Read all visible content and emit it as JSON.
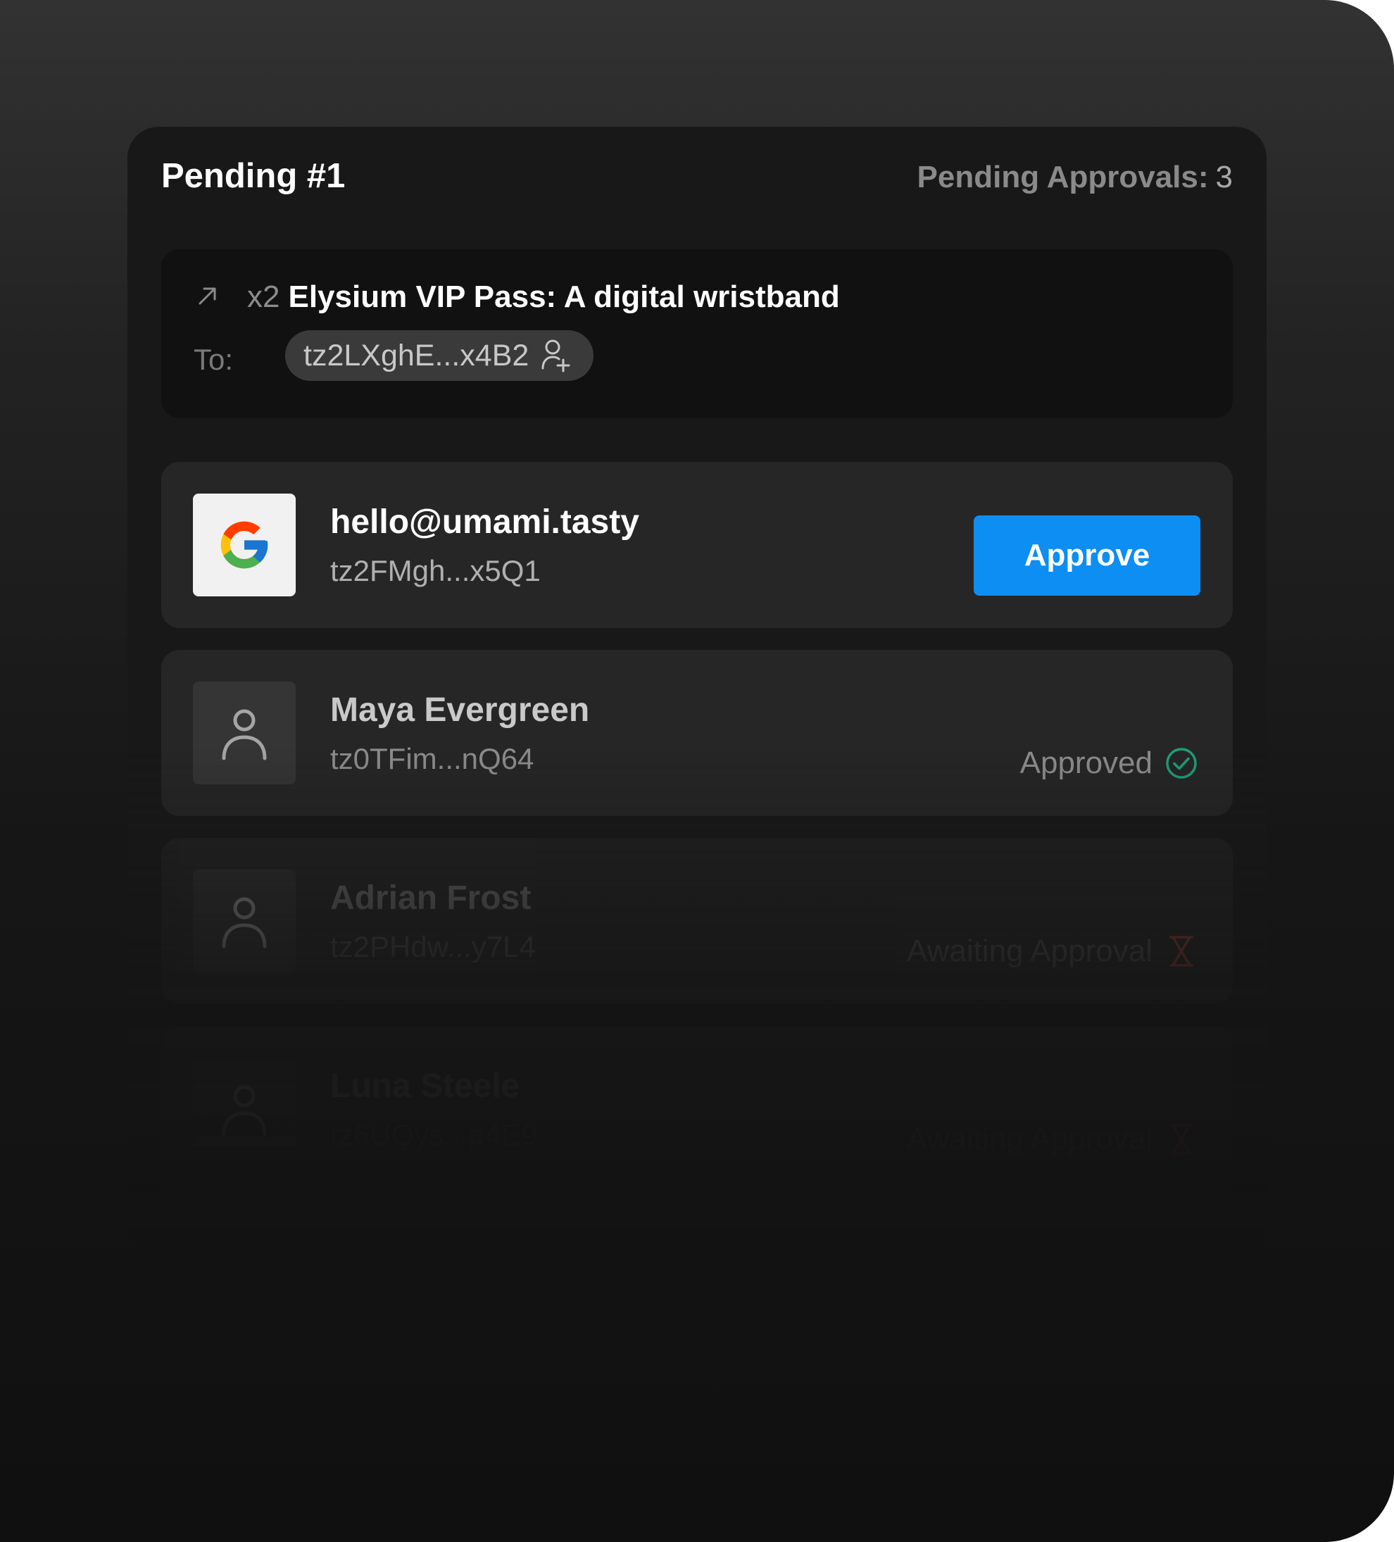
{
  "panel": {
    "title": "Pending #1",
    "pending_label": "Pending Approvals:",
    "pending_count": "3"
  },
  "transfer": {
    "icon": "arrow-up-right-icon",
    "quantity": "x2",
    "item_name": "Elysium VIP Pass: A digital wristband",
    "to_label": "To:",
    "to_address": "tz2LXghE...x4B2",
    "to_icon": "add-user-icon"
  },
  "signers": [
    {
      "name": "hello@umami.tasty",
      "address": "tz2FMgh...x5Q1",
      "avatar_icon": "google-icon",
      "action_label": "Approve"
    },
    {
      "name": "Maya Evergreen",
      "address": "tz0TFim...nQ64",
      "avatar_icon": "user-icon",
      "status": "Approved",
      "status_icon": "check-circle-icon"
    },
    {
      "name": "Adrian Frost",
      "address": "tz2PHdw...y7L4",
      "avatar_icon": "user-icon",
      "status": "Awaiting Approval",
      "status_icon": "hourglass-icon"
    },
    {
      "name": "Luna Steele",
      "address": "tz6UQys...p4E9",
      "avatar_icon": "user-icon",
      "status": "Awaiting Approval",
      "status_icon": "hourglass-icon"
    }
  ],
  "colors": {
    "accent": "#0d8ef2",
    "approved": "#1fa07a",
    "awaiting": "#b8433e",
    "panel_bg": "#181818",
    "row_bg": "#262626"
  }
}
